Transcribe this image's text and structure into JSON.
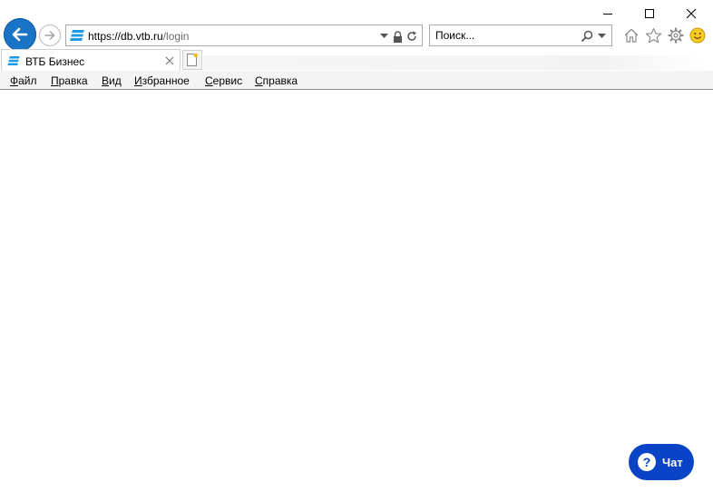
{
  "window": {
    "controls": [
      "minimize",
      "maximize",
      "close"
    ]
  },
  "nav": {
    "back_icon": "back-arrow-icon",
    "forward_icon": "forward-arrow-icon"
  },
  "address_bar": {
    "url_host": "https://db.vtb.ru",
    "url_path": "/login",
    "site_icon": "vtb-logo-icon",
    "controls": [
      "dropdown-icon",
      "lock-icon",
      "refresh-icon"
    ]
  },
  "search": {
    "placeholder": "Поиск...",
    "controls": [
      "search-icon",
      "dropdown-icon"
    ]
  },
  "toolbar_icons": [
    "home-icon",
    "favorites-star-icon",
    "settings-gear-icon",
    "smiley-feedback-icon"
  ],
  "tabs": [
    {
      "title": "ВТБ Бизнес",
      "active": true,
      "icon": "vtb-logo-icon"
    }
  ],
  "menu": {
    "items": [
      {
        "label": "Файл",
        "accel": "Ф",
        "rest": "айл"
      },
      {
        "label": "Правка",
        "accel": "П",
        "rest": "равка"
      },
      {
        "label": "Вид",
        "accel": "В",
        "rest": "ид"
      },
      {
        "label": "Избранное",
        "accel": "И",
        "rest": "збранное"
      },
      {
        "label": "Сервис",
        "accel": "С",
        "rest": "ервис"
      },
      {
        "label": "Справка",
        "accel": "С",
        "rest": "правка"
      }
    ]
  },
  "chat": {
    "label": "Чат",
    "icon_glyph": "?"
  },
  "colors": {
    "back_button": "#1a74c6",
    "chat_button": "#0a44c6",
    "vtb_logo": "#1d9be6"
  }
}
